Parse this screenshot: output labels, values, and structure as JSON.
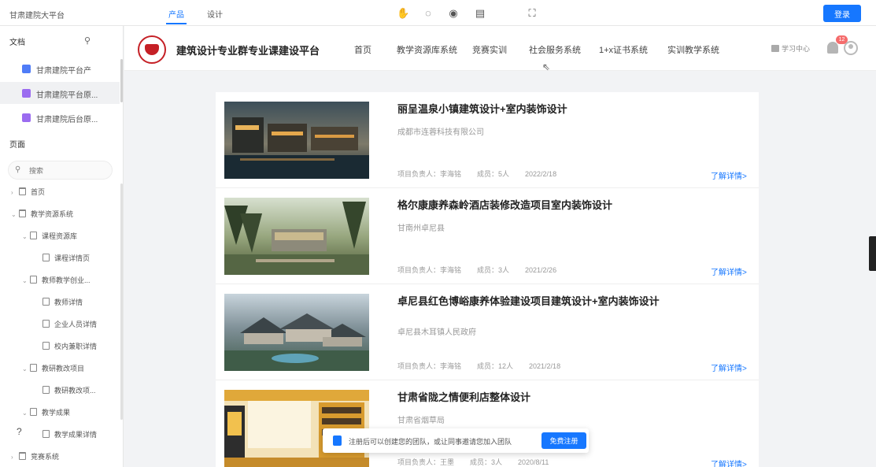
{
  "toolbar": {
    "workspace_title": "甘肃建院大平台",
    "tabs": [
      "产品",
      "设计"
    ],
    "icons": [
      "hand-icon",
      "comment-icon",
      "eye-icon",
      "notes-icon",
      "fullscreen-icon"
    ],
    "login_label": "登录"
  },
  "sidebar": {
    "docs_heading": "文档",
    "documents": [
      "甘肃建院平台产",
      "甘肃建院平台原...",
      "甘肃建院后台原..."
    ],
    "doc_badge_colors": [
      "#4f7cf7",
      "#9b6cf0",
      "#9b6cf0"
    ],
    "pages_heading": "页面",
    "search_placeholder": "搜索",
    "tree": [
      {
        "label": "首页",
        "level": 0,
        "type": "folder",
        "arrow": "›"
      },
      {
        "label": "教学资源系统",
        "level": 0,
        "type": "folder",
        "arrow": "⌄"
      },
      {
        "label": "课程资源库",
        "level": 1,
        "type": "page",
        "arrow": "⌄"
      },
      {
        "label": "课程详情页",
        "level": 2,
        "type": "page",
        "arrow": ""
      },
      {
        "label": "教师教学创业...",
        "level": 1,
        "type": "page",
        "arrow": "⌄"
      },
      {
        "label": "教师详情",
        "level": 2,
        "type": "page",
        "arrow": ""
      },
      {
        "label": "企业人员详情",
        "level": 2,
        "type": "page",
        "arrow": ""
      },
      {
        "label": "校内兼职详情",
        "level": 2,
        "type": "page",
        "arrow": ""
      },
      {
        "label": "教研教改项目",
        "level": 1,
        "type": "page",
        "arrow": "⌄"
      },
      {
        "label": "教研教改项...",
        "level": 2,
        "type": "page",
        "arrow": ""
      },
      {
        "label": "教学成果",
        "level": 1,
        "type": "page",
        "arrow": "⌄"
      },
      {
        "label": "教学成果详情",
        "level": 2,
        "type": "page",
        "arrow": ""
      },
      {
        "label": "竞赛系统",
        "level": 0,
        "type": "folder",
        "arrow": "›"
      }
    ],
    "help_label": "?"
  },
  "site": {
    "title": "建筑设计专业群专业课建设平台",
    "nav": [
      "首页",
      "教学资源库系统",
      "竞赛实训",
      "社会服务系统",
      "1+x证书系统",
      "实训教学系统"
    ],
    "study_center": "学习中心",
    "notification_count": "12"
  },
  "projects": [
    {
      "title": "丽呈温泉小镇建筑设计+室内装饰设计",
      "org": "成都市连蓉科技有限公司",
      "leader": "项目负责人：李海铭",
      "members": "成员：5人",
      "date": "2022/2/18",
      "more": "了解详情>"
    },
    {
      "title": "格尔康康养森岭酒店装修改造项目室内装饰设计",
      "org": "甘南州卓尼县",
      "leader": "项目负责人：李海铭",
      "members": "成员：3人",
      "date": "2021/2/26",
      "more": "了解详情>"
    },
    {
      "title": "卓尼县红色博峪康养体验建设项目建筑设计+室内装饰设计",
      "org": "卓尼县木耳镇人民政府",
      "leader": "项目负责人：李海铭",
      "members": "成员：12人",
      "date": "2021/2/18",
      "more": "了解详情>"
    },
    {
      "title": "甘肃省陇之情便利店整体设计",
      "org": "甘肃省烟草局",
      "leader": "项目负责人：王墨",
      "members": "成员：3人",
      "date": "2020/8/11",
      "more": "了解详情>"
    }
  ],
  "toast": {
    "text": "注册后可以创建您的团队，或让同事邀请您加入团队",
    "button": "免费注册"
  },
  "colors": {
    "accent": "#1677ff",
    "badge": "#f56c6c",
    "logo_red": "#c52026"
  }
}
